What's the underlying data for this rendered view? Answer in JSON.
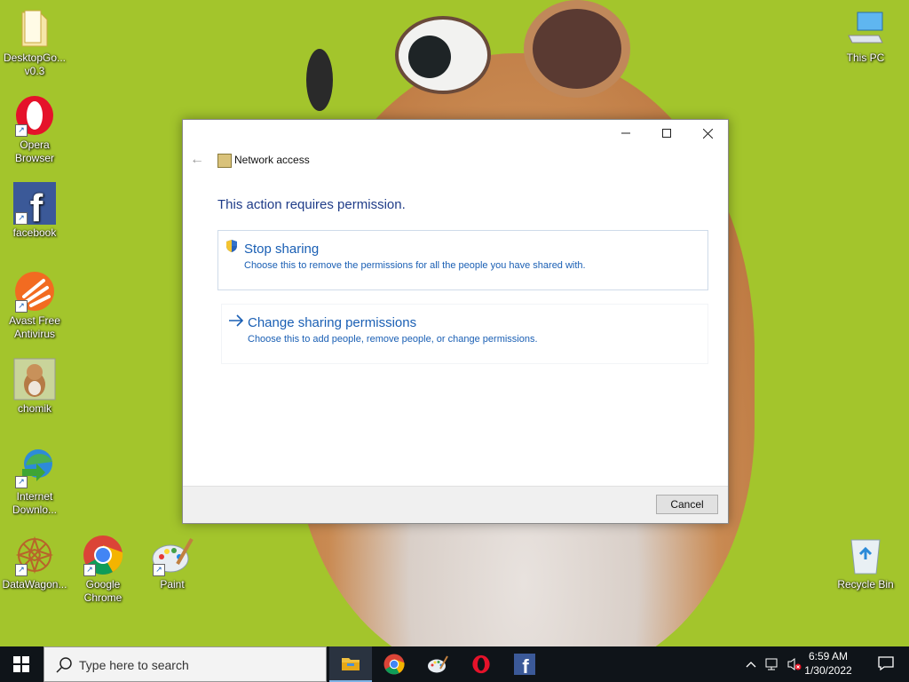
{
  "desktop": {
    "icons": [
      {
        "label": "DesktopGo... v0.3",
        "icon": "folder-icon"
      },
      {
        "label": "Opera Browser",
        "icon": "opera-icon"
      },
      {
        "label": "facebook",
        "icon": "facebook-icon"
      },
      {
        "label": "Avast Free Antivirus",
        "icon": "avast-icon"
      },
      {
        "label": "chomik",
        "icon": "hamster-icon"
      },
      {
        "label": "Internet Downlo...",
        "icon": "idm-icon"
      },
      {
        "label": "DataWagon...",
        "icon": "datawagon-icon"
      },
      {
        "label": "Google Chrome",
        "icon": "chrome-icon"
      },
      {
        "label": "Paint",
        "icon": "paint-icon"
      },
      {
        "label": "This PC",
        "icon": "computer-icon"
      },
      {
        "label": "Recycle Bin",
        "icon": "recycle-bin-icon"
      }
    ]
  },
  "dialog": {
    "nav_title": "Network access",
    "heading": "This action requires permission.",
    "options": [
      {
        "title": "Stop sharing",
        "description": "Choose this to remove the permissions for all the people you have shared with.",
        "icon": "shield-icon"
      },
      {
        "title": "Change sharing permissions",
        "description": "Choose this to add people, remove people, or change permissions.",
        "icon": "arrow-right-icon"
      }
    ],
    "cancel_label": "Cancel"
  },
  "taskbar": {
    "search_placeholder": "Type here to search",
    "time": "6:59 AM",
    "date": "1/30/2022"
  },
  "colors": {
    "accent": "#1a5fb4",
    "heading": "#1f3c88",
    "taskbar": "#0f1419",
    "wallpaper": "#a3c52c"
  }
}
